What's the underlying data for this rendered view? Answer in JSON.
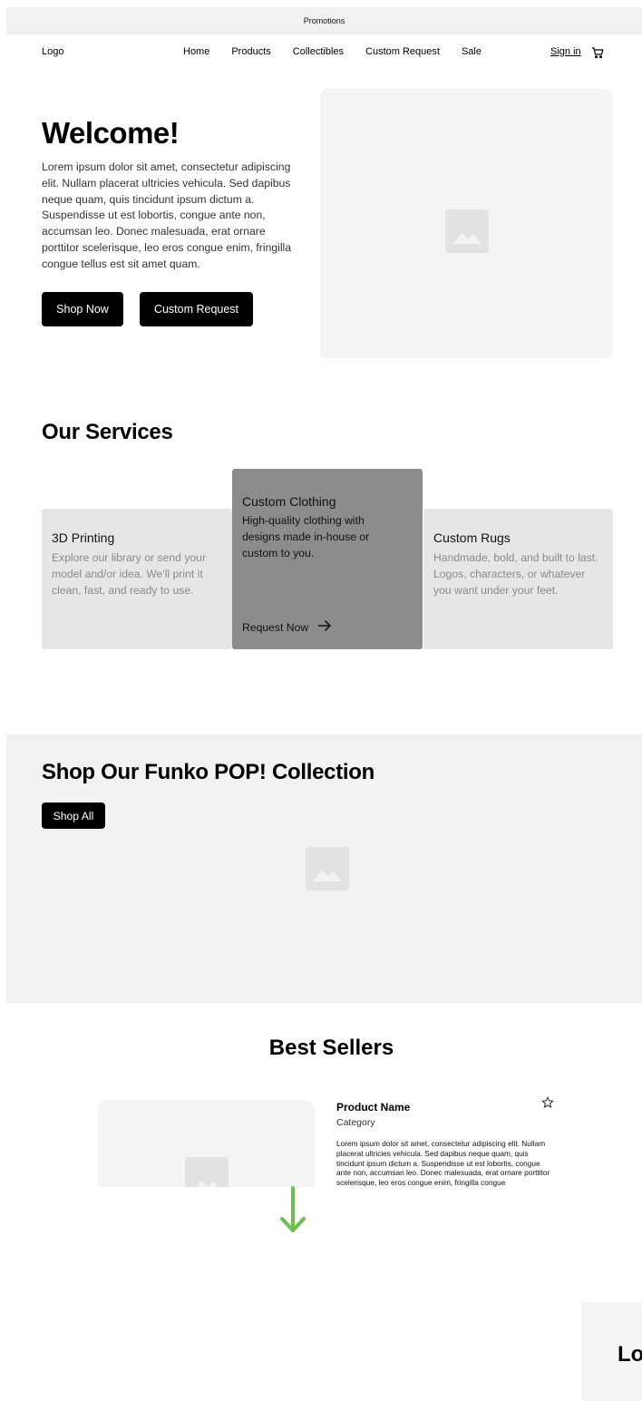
{
  "promo": {
    "text": "Promotions"
  },
  "nav": {
    "logo": "Logo",
    "links": [
      "Home",
      "Products",
      "Collectibles",
      "Custom Request",
      "Sale"
    ],
    "sign_in": "Sign in"
  },
  "hero": {
    "title": "Welcome!",
    "body": "Lorem ipsum dolor sit amet, consectetur adipiscing elit. Nullam placerat ultricies vehicula. Sed dapibus neque quam, quis tincidunt ipsum dictum a. Suspendisse ut est lobortis, congue ante non, accumsan leo. Donec malesuada, erat ornare porttitor scelerisque, leo eros congue enim, fringilla congue tellus est sit amet quam.",
    "shop_now": "Shop Now",
    "custom_request": "Custom Request"
  },
  "services": {
    "title": "Our Services",
    "cards": [
      {
        "title": "3D Printing",
        "text": "Explore our library or send your model and/or idea. We'll print it clean, fast, and ready to use."
      },
      {
        "title": "Custom Clothing",
        "text": "High-quality clothing with designs made in-house or custom to you.",
        "link": "Request Now"
      },
      {
        "title": "Custom Rugs",
        "text": "Handmade, bold, and built to last. Logos, characters, or whatever you want under your feet."
      }
    ]
  },
  "funko": {
    "title": "Shop Our Funko POP! Collection",
    "button": "Shop All"
  },
  "best_sellers": {
    "title": "Best Sellers",
    "product_name": "Product Name",
    "category": "Category",
    "description": "Lorem ipsum dolor sit amet, consectetur adipiscing elit. Nullam placerat ultricies vehicula. Sed dapibus neque quam, quis tincidunt ipsum dictum a. Suspendisse ut est lobortis, congue ante non, accumsan leo. Donec malesuada, erat ornare porttitor scelerisque, leo eros congue enim, fringilla congue"
  },
  "partial": {
    "text": "Lo"
  },
  "colors": {
    "arrow": "#6cbf4a",
    "placeholder_bg": "#f4f4f4",
    "highlight_card": "#8c8c8c"
  }
}
